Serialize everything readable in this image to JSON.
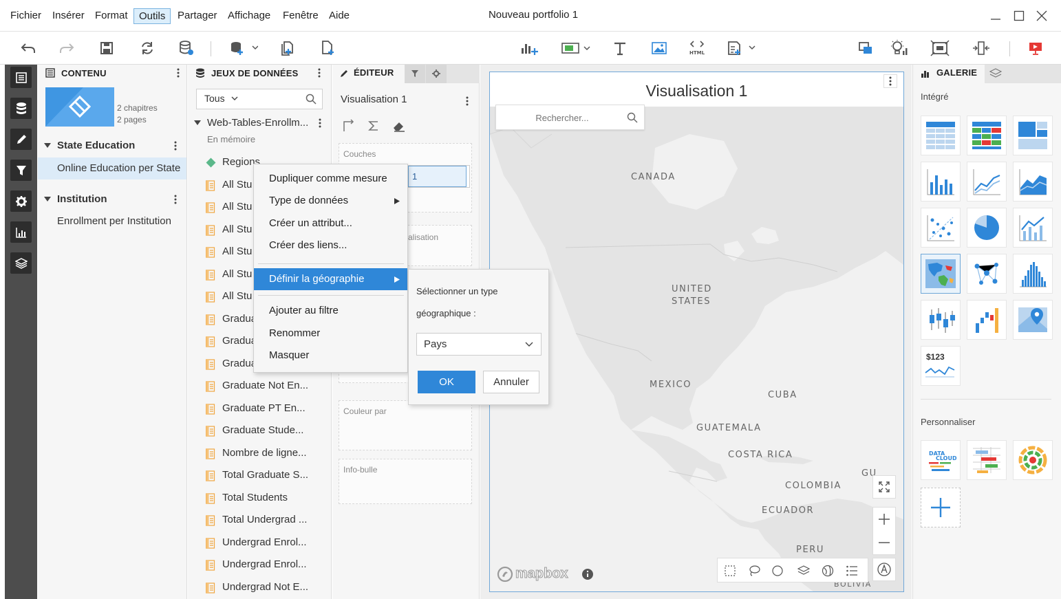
{
  "menubar": {
    "items": [
      "Fichier",
      "Insérer",
      "Format",
      "Outils",
      "Partager",
      "Affichage",
      "Fenêtre",
      "Aide"
    ],
    "active_item": "Outils",
    "title": "Nouveau portfolio 1"
  },
  "toolbar": {
    "left_icons": [
      "undo-icon",
      "redo-icon",
      "save-icon",
      "refresh-icon",
      "data-source-icon",
      "add-data-icon",
      "duplicate-page-icon",
      "new-page-icon"
    ],
    "center_icons": [
      "add-visualization-icon",
      "filter-selector-icon",
      "text-icon",
      "image-icon",
      "html-icon",
      "widget-icon"
    ],
    "right_icons": [
      "layout-icon",
      "insights-icon",
      "screen-fit-icon",
      "resize-icon",
      "present-icon"
    ],
    "html_label": "HTML",
    "accent_color": "#2f87d8",
    "present_color": "#e53935"
  },
  "contenu": {
    "header": "CONTENU",
    "thumbnail_chapters": "2 chapitres",
    "thumbnail_pages": "2 pages",
    "chapters": [
      {
        "title": "State Education",
        "pages": [
          "Online Education per State"
        ],
        "selected_page": "Online Education per State"
      },
      {
        "title": "Institution",
        "pages": [
          "Enrollment per Institution"
        ]
      }
    ]
  },
  "datasets": {
    "header": "JEUX DE DONNÉES",
    "filter_value": "Tous",
    "source_name": "Web-Tables-Enrollm...",
    "source_mode": "En mémoire",
    "items": [
      {
        "label": "Regions",
        "kind": "attribute"
      },
      {
        "label": "All Stu",
        "kind": "metric"
      },
      {
        "label": "All Stu",
        "kind": "metric"
      },
      {
        "label": "All Stu",
        "kind": "metric"
      },
      {
        "label": "All Stu",
        "kind": "metric"
      },
      {
        "label": "All Stu",
        "kind": "metric"
      },
      {
        "label": "All Stu",
        "kind": "metric"
      },
      {
        "label": "Gradua",
        "kind": "metric"
      },
      {
        "label": "Gradua",
        "kind": "metric"
      },
      {
        "label": "Gradua",
        "kind": "metric"
      },
      {
        "label": "Graduate Not En...",
        "kind": "metric"
      },
      {
        "label": "Graduate PT En...",
        "kind": "metric"
      },
      {
        "label": "Graduate Stude...",
        "kind": "metric"
      },
      {
        "label": "Nombre de ligne...",
        "kind": "metric"
      },
      {
        "label": "Total Graduate S...",
        "kind": "metric"
      },
      {
        "label": "Total Students",
        "kind": "metric"
      },
      {
        "label": "Total Undergrad ...",
        "kind": "metric"
      },
      {
        "label": "Undergrad Enrol...",
        "kind": "metric"
      },
      {
        "label": "Undergrad Enrol...",
        "kind": "metric"
      },
      {
        "label": "Undergrad Not E...",
        "kind": "metric"
      }
    ]
  },
  "editor": {
    "tab_label": "ÉDITEUR",
    "viz_name": "Visualisation 1",
    "zones": {
      "couches": "Couches",
      "couches_value": "1",
      "localisation": "alisation",
      "couleur": "Couleur par",
      "infobulle": "Info-bulle"
    }
  },
  "context_menu": {
    "items": [
      {
        "label": "Dupliquer comme mesure",
        "submenu": false
      },
      {
        "label": "Type de données",
        "submenu": true
      },
      {
        "label": "Créer un attribut...",
        "submenu": false
      },
      {
        "label": "Créer des liens...",
        "submenu": false
      },
      {
        "label": "Définir la géographie",
        "submenu": true,
        "highlighted": true
      },
      {
        "label": "Ajouter au filtre",
        "submenu": false
      },
      {
        "label": "Renommer",
        "submenu": false
      },
      {
        "label": "Masquer",
        "submenu": false
      }
    ]
  },
  "geo_panel": {
    "label_line1": "Sélectionner un type",
    "label_line2": "géographique :",
    "selected": "Pays",
    "ok": "OK",
    "cancel": "Annuler"
  },
  "visualization": {
    "title": "Visualisation 1",
    "search_placeholder": "Rechercher...",
    "map_labels": [
      "CANADA",
      "UNITED",
      "STATES",
      "MEXICO",
      "CUBA",
      "GUATEMALA",
      "COSTA RICA",
      "COLOMBIA",
      "ECUADOR",
      "PERU",
      "GU",
      "BOLIVIA"
    ],
    "attribution": "mapbox"
  },
  "gallery": {
    "tab_label": "GALERIE",
    "section_builtin": "Intégré",
    "section_custom": "Personnaliser",
    "tiles": [
      "grid-table-icon",
      "heatmap-grid-icon",
      "kpi-layout-icon",
      "vertical-bar-icon",
      "line-chart-icon",
      "area-chart-icon",
      "scatter-icon",
      "pie-chart-icon",
      "combo-chart-icon",
      "map-chart-icon",
      "network-icon",
      "histogram-icon",
      "box-plot-icon",
      "waterfall-icon",
      "map-pin-icon",
      "kpi-sparkline-icon"
    ],
    "kpi_label": "$123",
    "selected_tile": "map-chart-icon",
    "custom_tiles": [
      "data-cloud-icon",
      "gantt-icon",
      "sunburst-icon",
      "add-custom-icon"
    ],
    "datacloud_line1": "DATA",
    "datacloud_line2": "CLOUD"
  }
}
